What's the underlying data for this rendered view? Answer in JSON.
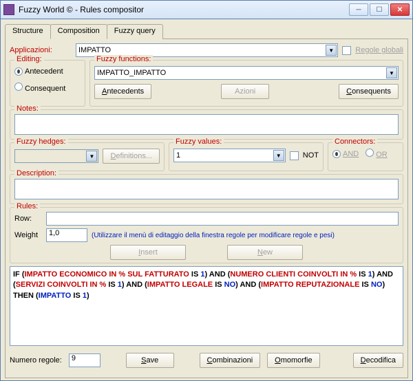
{
  "window": {
    "title": "Fuzzy World © - Rules compositor"
  },
  "tabs": {
    "structure": "Structure",
    "composition": "Composition",
    "fuzzy_query": "Fuzzy query"
  },
  "app_row": {
    "label": "Applicazioni:",
    "value": "IMPATTO",
    "regole_globali": "Regole globali"
  },
  "editing": {
    "title": "Editing:",
    "antecedent": "Antecedent",
    "consequent": "Consequent"
  },
  "fuzzy_functions": {
    "title": "Fuzzy functions:",
    "value": "IMPATTO_IMPATTO",
    "btn_antecedents": "Antecedents",
    "btn_azioni": "Azioni",
    "btn_consequents": "Consequents"
  },
  "notes": {
    "title": "Notes:"
  },
  "hedges": {
    "title": "Fuzzy hedges:",
    "btn_definitions": "Definitions..."
  },
  "values": {
    "title": "Fuzzy values:",
    "value": "1",
    "not_label": "NOT"
  },
  "connectors": {
    "title": "Connectors:",
    "and": "AND",
    "or": "OR"
  },
  "description": {
    "title": "Description:"
  },
  "rules": {
    "title": "Rules:",
    "row_label": "Row:",
    "weight_label": "Weight",
    "weight_value": "1,0",
    "hint": "(Utilizzare il menù di editaggio della finestra regole per modificare regole e pesi)",
    "btn_insert": "Insert",
    "btn_new": "New",
    "rule_tokens": [
      {
        "t": "IF (",
        "c": "black"
      },
      {
        "t": "IMPATTO ECONOMICO IN % SUL FATTURATO",
        "c": "red"
      },
      {
        "t": " IS ",
        "c": "black"
      },
      {
        "t": "1",
        "c": "blue"
      },
      {
        "t": ") AND (",
        "c": "black"
      },
      {
        "t": "NUMERO CLIENTI COINVOLTI IN %",
        "c": "red"
      },
      {
        "t": " IS ",
        "c": "black"
      },
      {
        "t": "1",
        "c": "blue"
      },
      {
        "t": ") AND (",
        "c": "black"
      },
      {
        "t": "SERVIZI COINVOLTI IN %",
        "c": "red"
      },
      {
        "t": " IS ",
        "c": "black"
      },
      {
        "t": "1",
        "c": "blue"
      },
      {
        "t": ") AND (",
        "c": "black"
      },
      {
        "t": "IMPATTO LEGALE",
        "c": "red"
      },
      {
        "t": " IS ",
        "c": "black"
      },
      {
        "t": "NO",
        "c": "blue"
      },
      {
        "t": ") AND (",
        "c": "black"
      },
      {
        "t": "IMPATTO REPUTAZIONALE",
        "c": "red"
      },
      {
        "t": " IS ",
        "c": "black"
      },
      {
        "t": "NO",
        "c": "blue"
      },
      {
        "t": ") THEN (",
        "c": "black"
      },
      {
        "t": "IMPATTO",
        "c": "blue"
      },
      {
        "t": " IS ",
        "c": "black"
      },
      {
        "t": "1",
        "c": "blue"
      },
      {
        "t": ")",
        "c": "black"
      }
    ]
  },
  "footer": {
    "numero_regole_label": "Numero regole:",
    "numero_regole_value": "9",
    "btn_save": "Save",
    "btn_combinazioni": "Combinazioni",
    "btn_omomorfie": "Omomorfie",
    "btn_decodifica": "Decodifica"
  }
}
